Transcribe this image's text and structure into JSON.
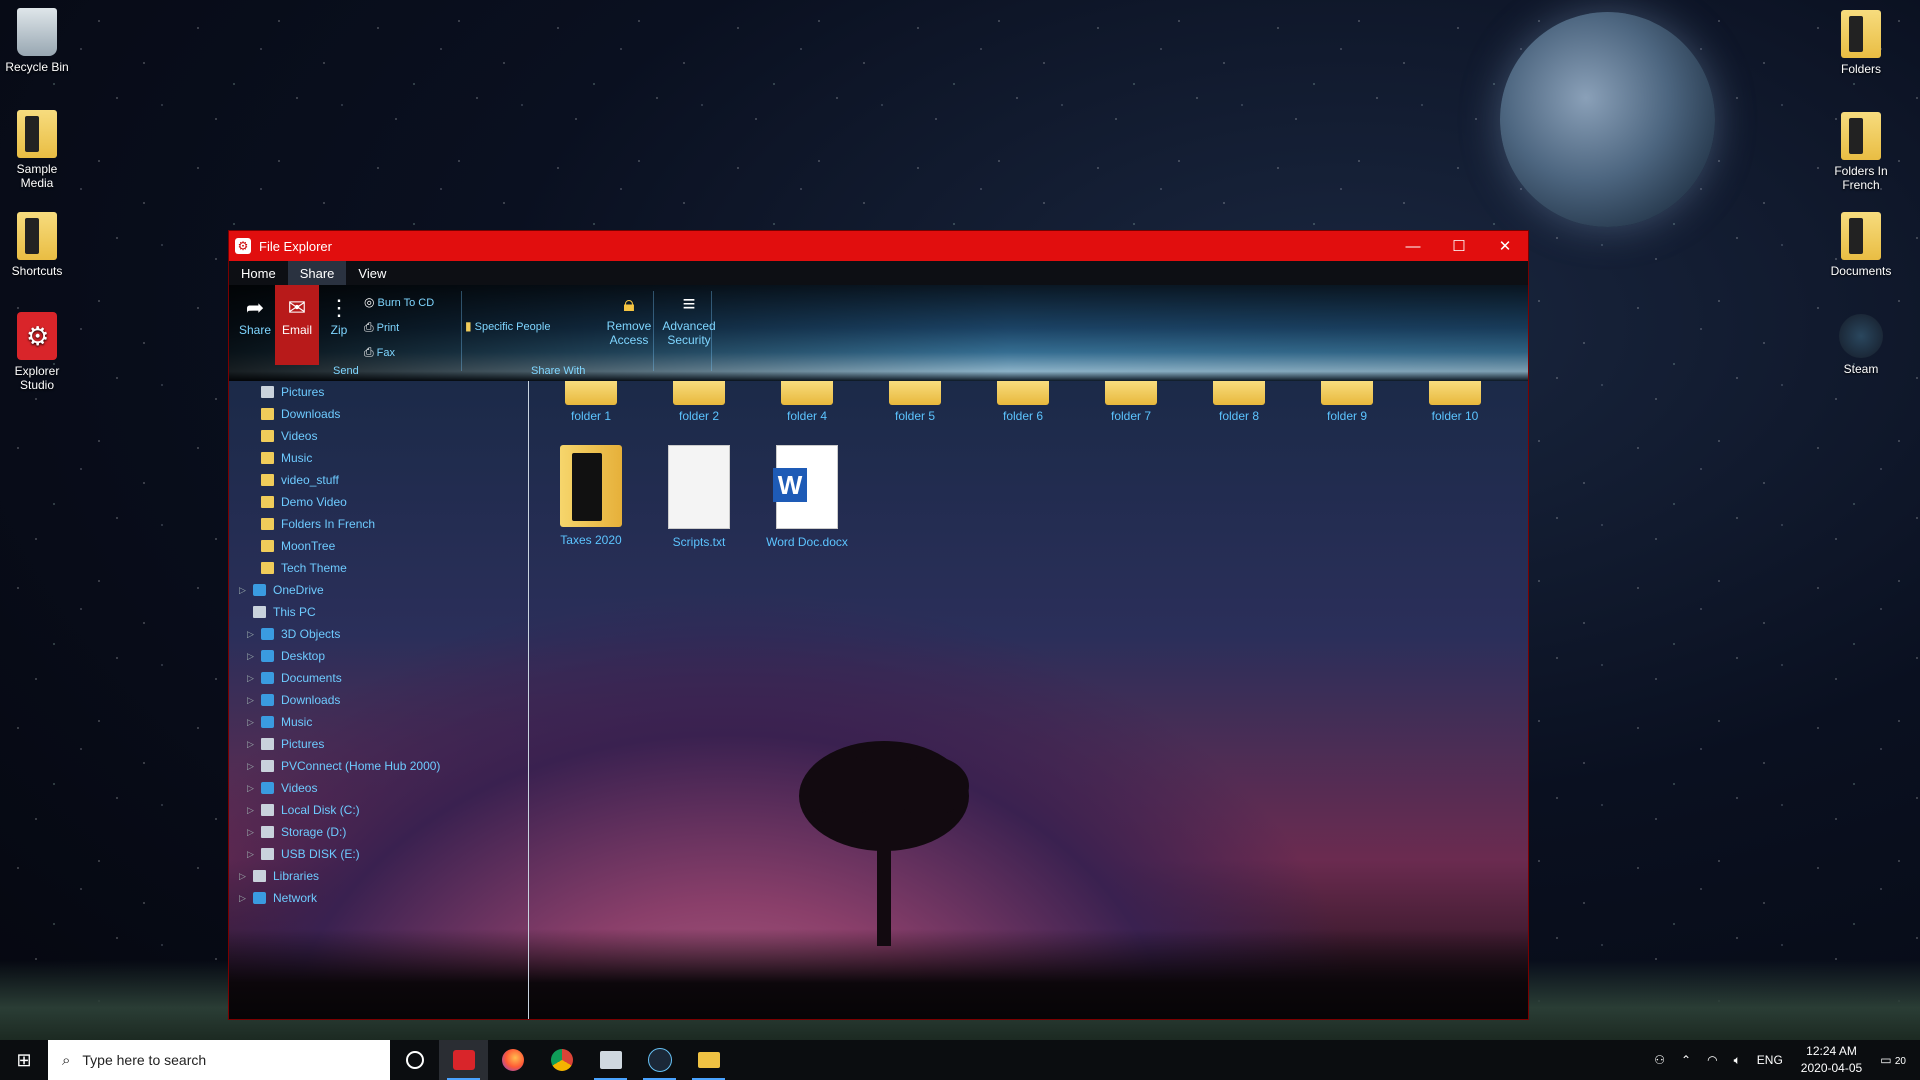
{
  "desktop": {
    "left_icons": [
      {
        "label": "Recycle Bin",
        "icon": "recycle-bin-icon"
      },
      {
        "label": "Sample Media",
        "icon": "folder-icon"
      },
      {
        "label": "Shortcuts",
        "icon": "folder-icon"
      },
      {
        "label": "Explorer Studio",
        "icon": "explorer-studio-icon"
      }
    ],
    "right_icons": [
      {
        "label": "Folders",
        "icon": "folder-icon"
      },
      {
        "label": "Folders In French",
        "icon": "folder-icon"
      },
      {
        "label": "Documents",
        "icon": "folder-icon"
      },
      {
        "label": "Steam",
        "icon": "steam-icon"
      }
    ]
  },
  "window": {
    "title": "File Explorer",
    "accent_color": "#e10e0e",
    "controls": [
      "—",
      "☐",
      "✕"
    ],
    "tabs": [
      "Home",
      "Share",
      "View"
    ],
    "active_tab": "Share",
    "ribbon": {
      "share": "Share",
      "email": "Email",
      "zip": "Zip",
      "burn": "Burn To CD",
      "print": "Print",
      "fax": "Fax",
      "send_group": "Send",
      "specific_people": "Specific People",
      "share_with_group": "Share With",
      "remove_access_1": "Remove",
      "remove_access_2": "Access",
      "advanced_security_1": "Advanced",
      "advanced_security_2": "Security"
    }
  },
  "nav": [
    {
      "label": "Pictures",
      "icon": "pictures-icon",
      "level": 2,
      "arrow": false
    },
    {
      "label": "Downloads",
      "icon": "folder-icon",
      "level": 2,
      "arrow": false
    },
    {
      "label": "Videos",
      "icon": "folder-icon",
      "level": 2,
      "arrow": false
    },
    {
      "label": "Music",
      "icon": "folder-icon",
      "level": 2,
      "arrow": false
    },
    {
      "label": "video_stuff",
      "icon": "folder-icon",
      "level": 2,
      "arrow": false
    },
    {
      "label": "Demo Video",
      "icon": "folder-icon",
      "level": 2,
      "arrow": false
    },
    {
      "label": "Folders In French",
      "icon": "folder-icon",
      "level": 2,
      "arrow": false
    },
    {
      "label": "MoonTree",
      "icon": "folder-icon",
      "level": 2,
      "arrow": false
    },
    {
      "label": "Tech Theme",
      "icon": "folder-icon",
      "level": 2,
      "arrow": false
    },
    {
      "label": "OneDrive",
      "icon": "cloud-icon",
      "level": 1,
      "arrow": true
    },
    {
      "label": "This PC",
      "icon": "computer-icon",
      "level": 1,
      "arrow": false
    },
    {
      "label": "3D Objects",
      "icon": "cube-icon",
      "level": 2,
      "arrow": true
    },
    {
      "label": "Desktop",
      "icon": "desktop-icon",
      "level": 2,
      "arrow": true
    },
    {
      "label": "Documents",
      "icon": "documents-icon",
      "level": 2,
      "arrow": true
    },
    {
      "label": "Downloads",
      "icon": "download-icon",
      "level": 2,
      "arrow": true
    },
    {
      "label": "Music",
      "icon": "music-icon",
      "level": 2,
      "arrow": true
    },
    {
      "label": "Pictures",
      "icon": "pictures-icon",
      "level": 2,
      "arrow": true
    },
    {
      "label": "PVConnect (Home Hub 2000)",
      "icon": "network-drive-icon",
      "level": 2,
      "arrow": true
    },
    {
      "label": "Videos",
      "icon": "videos-icon",
      "level": 2,
      "arrow": true
    },
    {
      "label": "Local Disk (C:)",
      "icon": "drive-icon",
      "level": 2,
      "arrow": true
    },
    {
      "label": "Storage (D:)",
      "icon": "drive-icon",
      "level": 2,
      "arrow": true
    },
    {
      "label": "USB DISK (E:)",
      "icon": "drive-icon",
      "level": 2,
      "arrow": true
    },
    {
      "label": "Libraries",
      "icon": "libraries-icon",
      "level": 1,
      "arrow": true
    },
    {
      "label": "Network",
      "icon": "network-icon",
      "level": 1,
      "arrow": true
    }
  ],
  "content": {
    "row1": [
      "folder 1",
      "folder 2",
      "folder 4",
      "folder 5",
      "folder 6",
      "folder 7",
      "folder 8",
      "folder 9",
      "folder 10"
    ],
    "row2": [
      {
        "label": "Taxes 2020",
        "type": "folder"
      },
      {
        "label": "Scripts.txt",
        "type": "text"
      },
      {
        "label": "Word Doc.docx",
        "type": "word"
      }
    ]
  },
  "taskbar": {
    "search_placeholder": "Type here to search",
    "apps": [
      "explorer-studio-icon",
      "firefox-icon",
      "chrome-icon",
      "photos-icon",
      "steam-icon",
      "file-explorer-icon"
    ],
    "language": "ENG",
    "time": "12:24 AM",
    "date": "2020-04-05",
    "notifications": "20"
  }
}
